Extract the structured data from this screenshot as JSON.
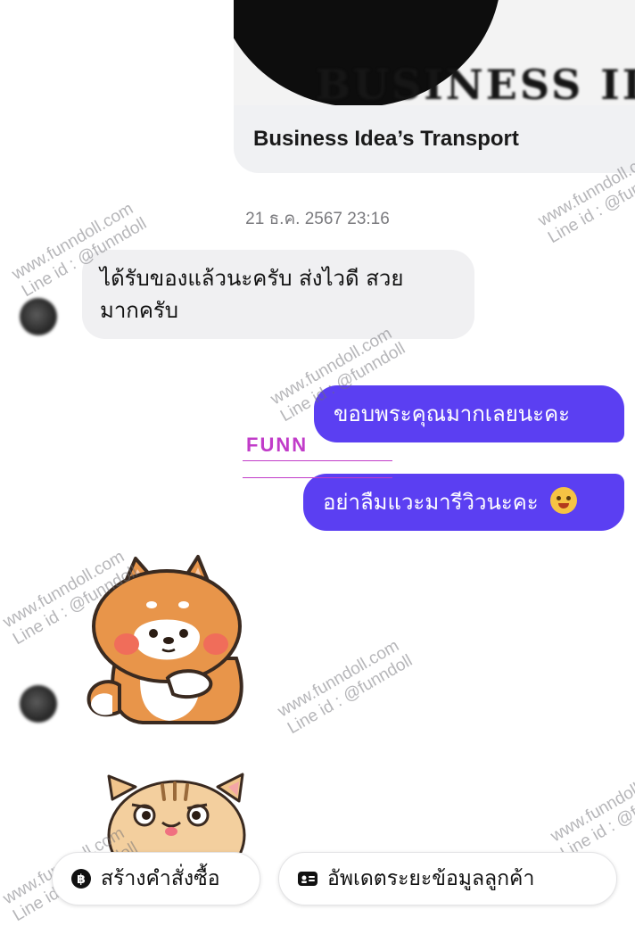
{
  "link_preview": {
    "image_text": "BUSINESS IDEA",
    "title": "Business Idea’s Transport"
  },
  "timestamp": "21 ธ.ค. 2567 23:16",
  "messages": {
    "incoming_1": {
      "line1": "ได้รับของแล้วนะครับ ส่งไวดี  สวย",
      "line2": "มากครับ"
    },
    "outgoing_1": "ขอบพระคุณมากเลยนะคะ",
    "outgoing_2": "อย่าลืมแวะมารีวิวนะคะ"
  },
  "brand_logo": "FUNN",
  "watermark": {
    "site": "www.funndoll.com",
    "line": "Line id : @funndoll"
  },
  "actions": {
    "create_order": "สร้างคำสั่งซื้อ",
    "update_customer": "อัพเดตระยะข้อมูลลูกค้า"
  },
  "icons": {
    "create_order": "baht-coin-icon",
    "update_customer": "id-card-icon",
    "emoji": "smiling-face-with-hearts-emoji"
  },
  "colors": {
    "outgoing_bubble": "#5b3ff2",
    "incoming_bubble": "#f0f0f2",
    "brand": "#c13cc9"
  }
}
